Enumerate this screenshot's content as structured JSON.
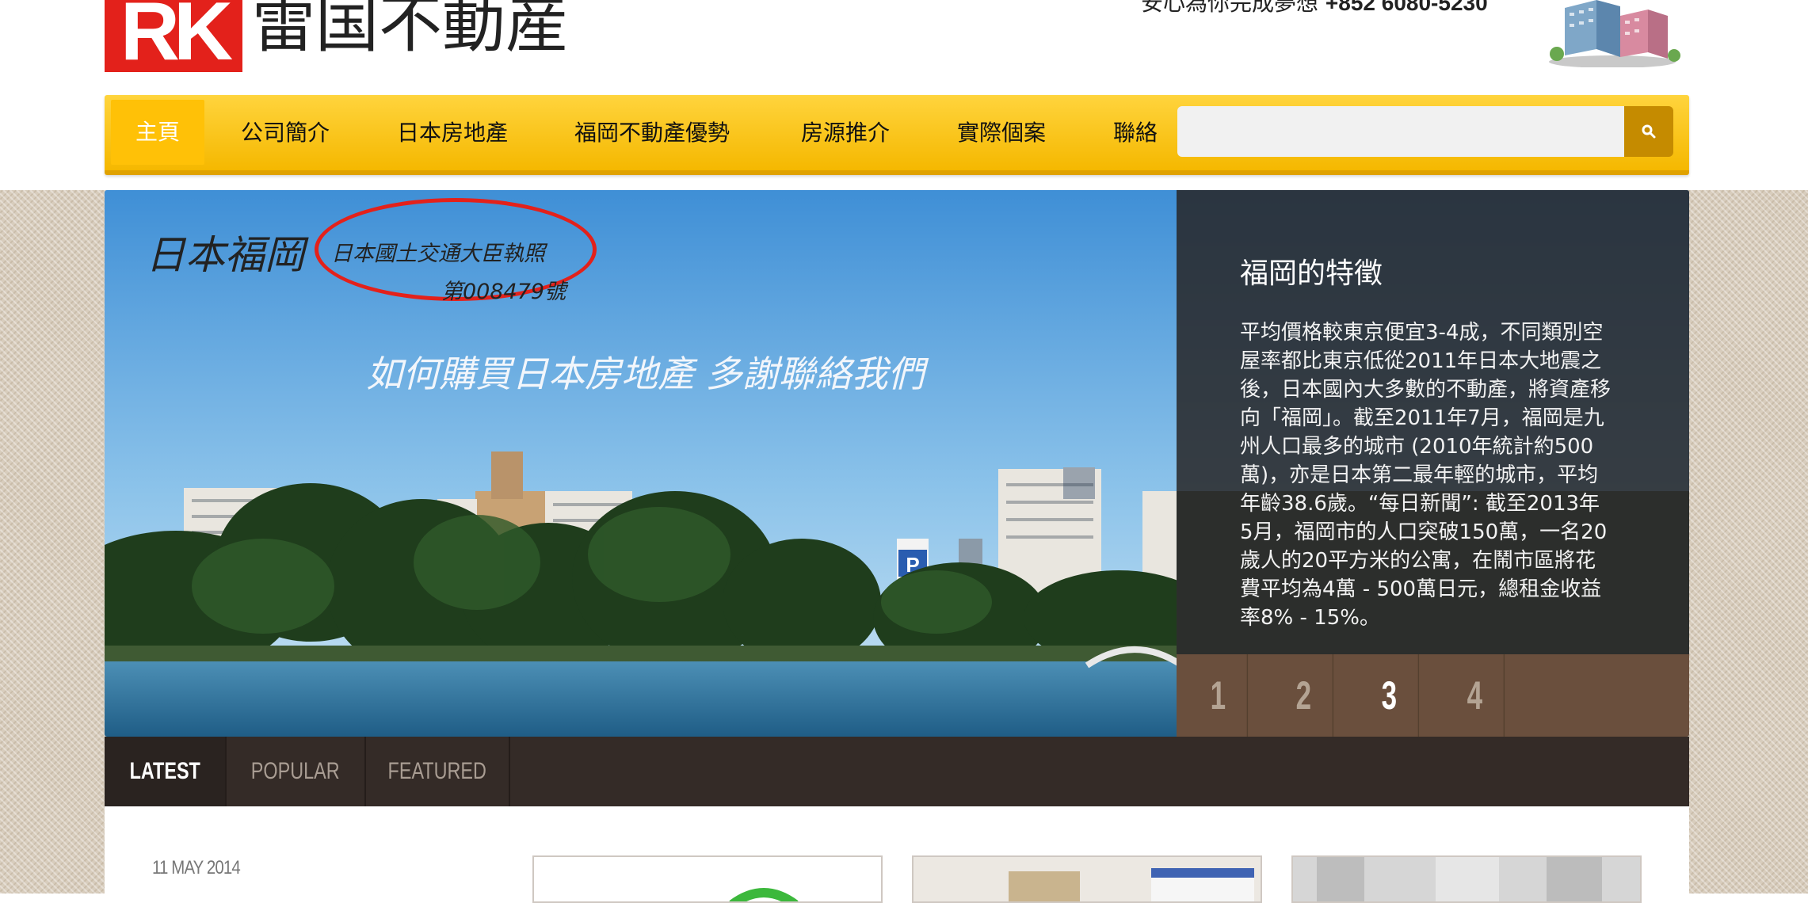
{
  "header": {
    "logo_letters": "RK",
    "company_name": "雷国不動産",
    "tagline": "安心為你完成夢想",
    "phone": "+852 6080-5230"
  },
  "nav": {
    "items": [
      {
        "label": "主頁",
        "active": true
      },
      {
        "label": "公司簡介"
      },
      {
        "label": "日本房地產"
      },
      {
        "label": "福岡不動產優勢"
      },
      {
        "label": "房源推介"
      },
      {
        "label": "實際個案"
      },
      {
        "label": "聯絡"
      }
    ],
    "search_placeholder": ""
  },
  "slider": {
    "image_title": "日本福岡",
    "license_line1": "日本國土交通大臣執照",
    "license_line2": "第008479號",
    "slogan": "如何購買日本房地產 多謝聯絡我們",
    "caption_title": "福岡的特徵",
    "caption_text": "平均價格較東京便宜3-4成，不同類別空屋率都比東京低從2011年日本大地震之後，日本國內大多數的不動產，將資產移向「福岡」。截至2011年7月，福岡是九州人口最多的城市 (2010年統計約500萬)，亦是日本第二最年輕的城市，平均年齡38.6歲。“每日新聞”: 截至2013年5月，福岡市的人口突破150萬，一名20歲人的20平方米的公寓，在鬧市區將花費平均為4萬 - 500萬日元，總租金收益率8% - 15%。",
    "pages": [
      "1",
      "2",
      "3",
      "4"
    ],
    "active_page": 3
  },
  "tabs": [
    {
      "label": "LATEST",
      "active": true
    },
    {
      "label": "POPULAR"
    },
    {
      "label": "FEATURED"
    }
  ],
  "content": {
    "date": "11 MAY 2014"
  },
  "colors": {
    "brand_red": "#e3211b",
    "nav_yellow": "#f5b800",
    "search_button": "#c58b00",
    "pager_brown": "#6a4f3d",
    "tab_bar": "#342b27"
  }
}
